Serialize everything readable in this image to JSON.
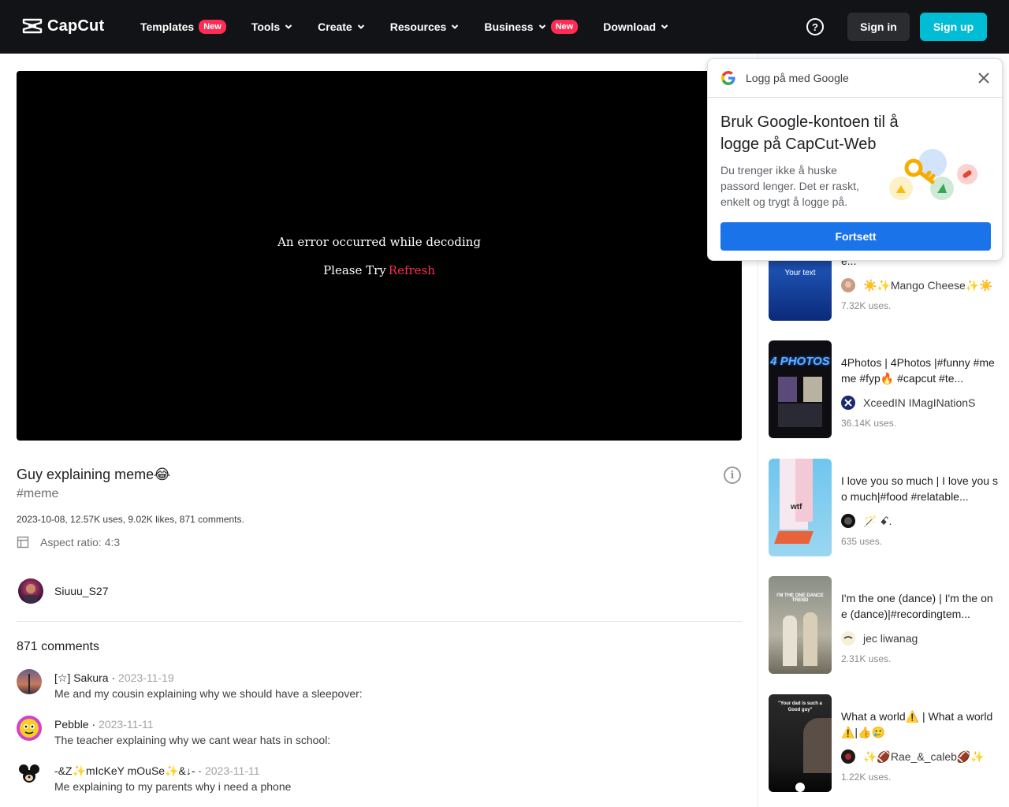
{
  "nav": {
    "logo_text": "CapCut",
    "items": [
      {
        "label": "Templates",
        "badge": "New",
        "chevron": false
      },
      {
        "label": "Tools",
        "badge": "",
        "chevron": true
      },
      {
        "label": "Create",
        "badge": "",
        "chevron": true
      },
      {
        "label": "Resources",
        "badge": "",
        "chevron": true
      },
      {
        "label": "Business",
        "badge": "New",
        "chevron": true
      },
      {
        "label": "Download",
        "badge": "",
        "chevron": true
      }
    ],
    "help_icon": "question-circle-icon",
    "signin_label": "Sign in",
    "signup_label": "Sign up",
    "signup_color": "#00bcd4"
  },
  "player": {
    "error_message": "An error occurred while decoding",
    "retry_prefix": "Please Try",
    "retry_link": "Refresh"
  },
  "template": {
    "title": "Guy explaining meme😂",
    "hashtag": "#meme",
    "stats": "2023-10-08, 12.57K uses, 9.02K likes, 871 comments.",
    "aspect_ratio": "Aspect ratio: 4:3",
    "author": "Siuuu_S27"
  },
  "comments": {
    "count_label": "871 comments",
    "items": [
      {
        "user": "[☆] Sakura",
        "date": "2023-11-19",
        "text": "Me and my cousin explaining why we should have a sleepover:"
      },
      {
        "user": "Pebble",
        "date": "2023-11-11",
        "text": "The teacher explaining why we cant wear hats in school:"
      },
      {
        "user": "-&Z✨mIcKeY mOuSe✨&↓-",
        "date": "2023-11-11",
        "text": "Me explaining to my parents why i need a phone"
      }
    ]
  },
  "recommended": [
    {
      "title": "HE END THOUGH 🌊🌊🌊|Re...",
      "author": "☀️✨Mango Cheese✨☀️",
      "uses": "7.32K uses.",
      "thumb_text": "Your text"
    },
    {
      "title": "4Photos | 4Photos |#funny #meme #fyp🔥 #capcut #te...",
      "author": "XceedIN IMagINationS",
      "uses": "36.14K uses.",
      "thumb_text": "4 PHOTOS"
    },
    {
      "title": "I love you so much | I love you so much|#food #relatable...",
      "author": "🪄 ꗃ.",
      "uses": "635 uses.",
      "thumb_text": "wtf"
    },
    {
      "title": "I'm the one (dance) | I'm the one (dance)|#recordingtem...",
      "author": "jec liwanag",
      "uses": "2.31K uses.",
      "thumb_text": "I'M THE ONE DANCE TREND"
    },
    {
      "title": "What a world⚠️ | What a world⚠️|👍🥲",
      "author": "✨🏈Rae_&_caleb🏈✨",
      "uses": "1.22K uses.",
      "thumb_text": "\"Your dad is such a Good guy\""
    }
  ],
  "google_popup": {
    "header": "Logg på med Google",
    "title": "Bruk Google-kontoen til å logge på CapCut-Web",
    "description": "Du trenger ikke å huske passord lenger. Det er raskt, enkelt og trygt å logge på.",
    "button": "Fortsett",
    "button_color": "#1a73e8"
  }
}
